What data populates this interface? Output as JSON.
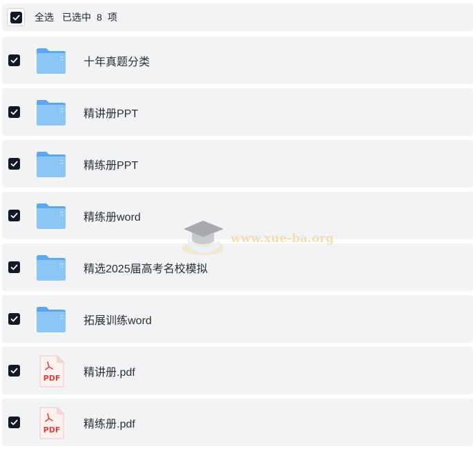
{
  "header": {
    "select_all_label": "全选",
    "selected_label": "已选中",
    "selected_count": "8",
    "unit_label": "项",
    "checked": true
  },
  "items": [
    {
      "name": "十年真题分类",
      "type": "folder",
      "checked": true
    },
    {
      "name": "精讲册PPT",
      "type": "folder",
      "checked": true
    },
    {
      "name": "精练册PPT",
      "type": "folder",
      "checked": true
    },
    {
      "name": "精练册word",
      "type": "folder",
      "checked": true
    },
    {
      "name": "精选2025届高考名校模拟",
      "type": "folder",
      "checked": true
    },
    {
      "name": "拓展训练word",
      "type": "folder",
      "checked": true
    },
    {
      "name": "精讲册.pdf",
      "type": "pdf",
      "checked": true
    },
    {
      "name": "精练册.pdf",
      "type": "pdf",
      "checked": true
    }
  ],
  "watermark": {
    "text": "www.xue-ba.org"
  },
  "colors": {
    "row_bg": "#f2f3f5",
    "checkbox": "#111827",
    "folder": "#6fb3f2",
    "pdf_red": "#e0403a"
  }
}
